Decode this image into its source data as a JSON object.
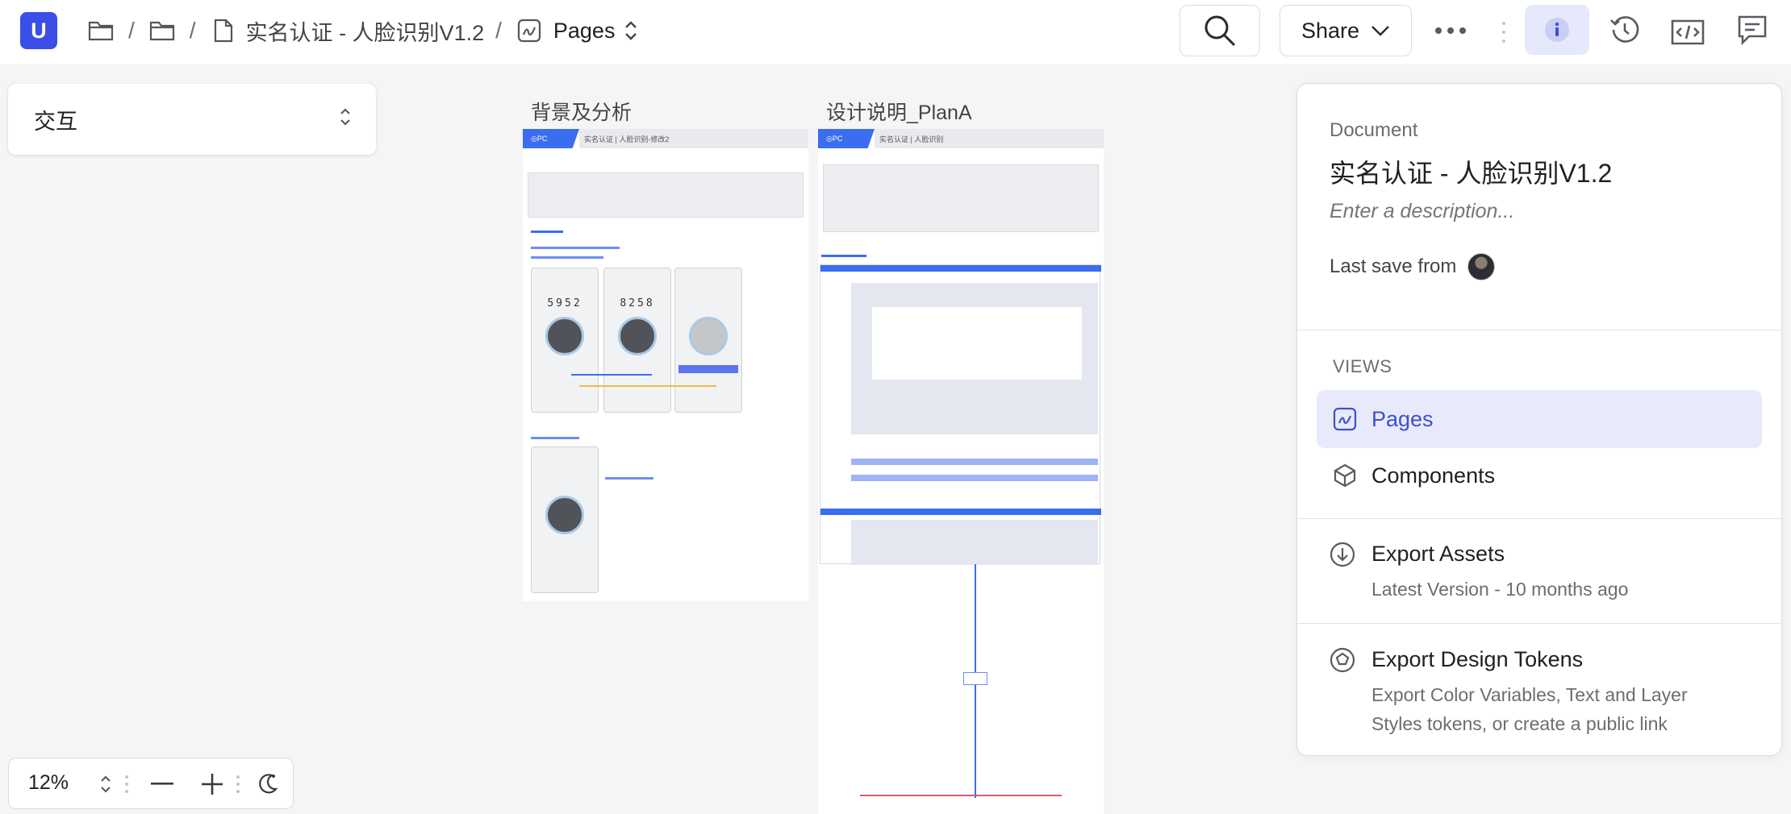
{
  "app": {
    "logo_letter": "U",
    "accent_color": "#3b4ee8"
  },
  "breadcrumb": {
    "items": [
      {
        "icon": "folder-icon"
      },
      {
        "icon": "folder-icon"
      },
      {
        "icon": "file-icon",
        "label": "实名认证 - 人脸识别V1.2"
      },
      {
        "icon": "pages-icon",
        "label": "Pages"
      }
    ]
  },
  "toolbar": {
    "share_label": "Share",
    "icons": [
      "search-icon",
      "chevron-down-icon",
      "more-icon",
      "info-icon",
      "history-icon",
      "code-icon",
      "comment-icon"
    ]
  },
  "page_select": {
    "value": "交互"
  },
  "canvas": {
    "artboards": [
      {
        "title": "背景及分析",
        "head_tag": "◎PC",
        "head_crumb": "实名认证 | 人脸识别-修改2",
        "numbers": [
          "5952",
          "8258"
        ]
      },
      {
        "title": "设计说明_PlanA",
        "head_tag": "◎PC",
        "head_crumb": "实名认证 | 人脸识别"
      }
    ]
  },
  "panel": {
    "doc_label": "Document",
    "doc_title": "实名认证 - 人脸识别V1.2",
    "description_placeholder": "Enter a description...",
    "last_save_label": "Last save from",
    "views_heading": "VIEWS",
    "views": [
      {
        "label": "Pages",
        "icon": "pages-icon",
        "active": true
      },
      {
        "label": "Components",
        "icon": "cube-icon",
        "active": false
      }
    ],
    "export_assets": {
      "title": "Export Assets",
      "subtitle": "Latest Version - 10 months ago"
    },
    "export_tokens": {
      "title": "Export Design Tokens",
      "subtitle": "Export Color Variables, Text and Layer Styles tokens, or create a public link"
    }
  },
  "zoom": {
    "value": "12%"
  }
}
